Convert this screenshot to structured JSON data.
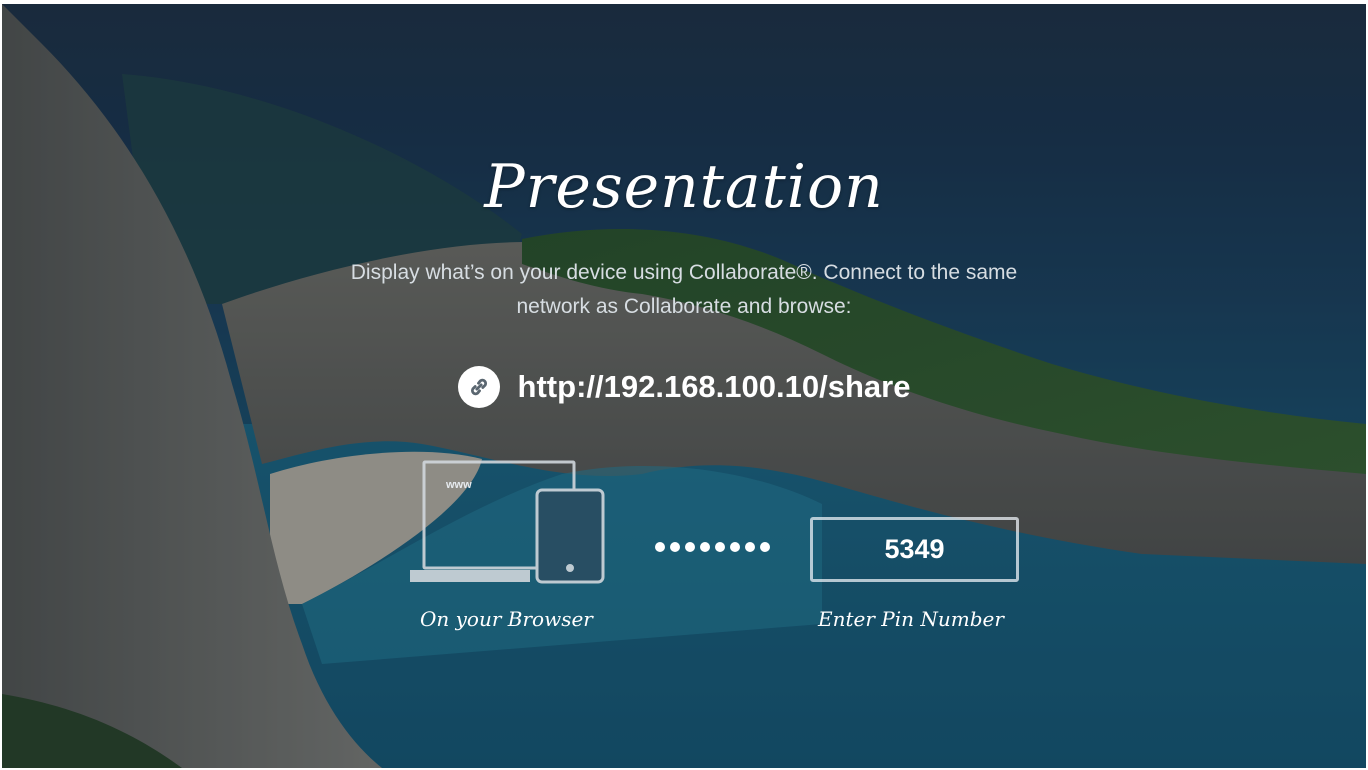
{
  "title": "Presentation",
  "description": "Display what’s on your device using Collaborate®. Connect to the same network as Collaborate and browse:",
  "share_url": "http://192.168.100.10/share",
  "browser_caption": "On your Browser",
  "device_screen_label": "www",
  "pin_value": "5349",
  "pin_caption": "Enter Pin Number",
  "icons": {
    "link": "link-icon",
    "devices": "laptop-tablet-icon"
  },
  "colors": {
    "text": "#ffffff",
    "subtext": "#d7dde2",
    "outline": "#ebf0f5"
  }
}
